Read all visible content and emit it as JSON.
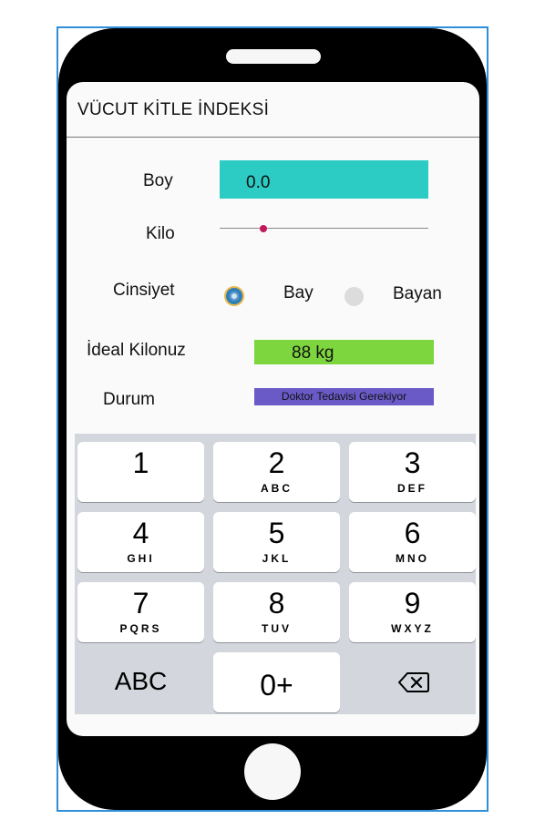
{
  "app": {
    "title": "VÜCUT KİTLE İNDEKSİ"
  },
  "form": {
    "height_label": "Boy",
    "height_value": "0.0",
    "weight_label": "Kilo",
    "weight_slider_fraction": 0.21,
    "gender_label": "Cinsiyet",
    "gender_options": [
      {
        "label": "Bay",
        "selected": true
      },
      {
        "label": "Bayan",
        "selected": false
      }
    ],
    "ideal_label": "İdeal Kilonuz",
    "ideal_value": "88 kg",
    "status_label": "Durum",
    "status_value": "Doktor Tedavisi Gerekiyor"
  },
  "keyboard": {
    "keys": [
      {
        "digit": "1",
        "letters": ""
      },
      {
        "digit": "2",
        "letters": "ABC"
      },
      {
        "digit": "3",
        "letters": "DEF"
      },
      {
        "digit": "4",
        "letters": "GHI"
      },
      {
        "digit": "5",
        "letters": "JKL"
      },
      {
        "digit": "6",
        "letters": "MNO"
      },
      {
        "digit": "7",
        "letters": "PQRS"
      },
      {
        "digit": "8",
        "letters": "TUV"
      },
      {
        "digit": "9",
        "letters": "WXYZ"
      }
    ],
    "abc_label": "ABC",
    "zero_label": "0+",
    "delete_icon": "backspace-icon"
  },
  "colors": {
    "height_field": "#2ccbc3",
    "ideal_field": "#7ed63f",
    "status_field": "#6a5ac8",
    "slider_thumb": "#c2185b",
    "frame_border": "#2f8fd8"
  }
}
